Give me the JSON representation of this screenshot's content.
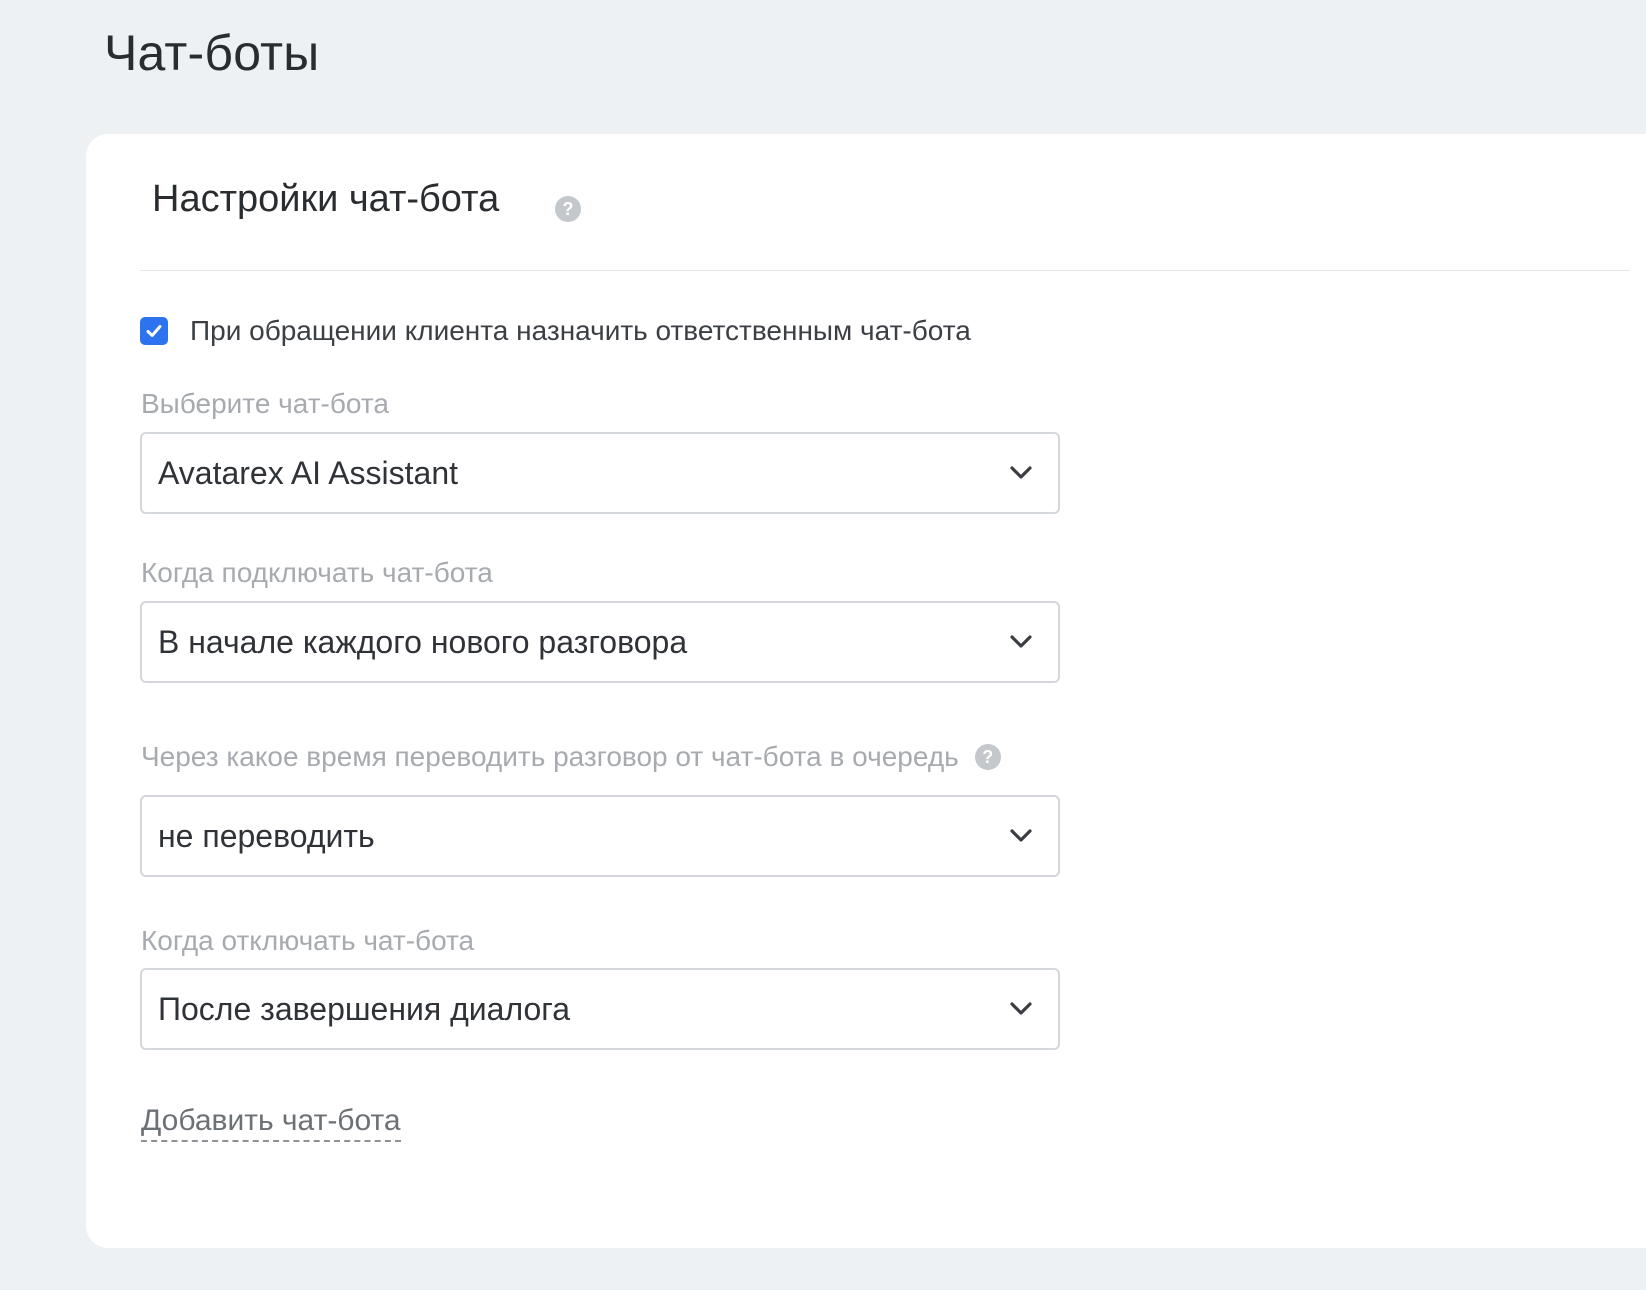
{
  "page": {
    "title": "Чат-боты"
  },
  "section": {
    "title": "Настройки чат-бота",
    "help_icon": "question-circle-icon"
  },
  "assign_checkbox": {
    "checked": true,
    "label": "При обращении клиента назначить ответственным чат-бота",
    "accent_color": "#2d72ef"
  },
  "fields": {
    "bot": {
      "label": "Выберите чат-бота",
      "value": "Avatarex AI Assistant"
    },
    "connect": {
      "label": "Когда подключать чат-бота",
      "value": "В начале каждого нового разговора"
    },
    "transfer": {
      "label": "Через какое время переводить разговор от чат-бота в очередь",
      "value": "не переводить",
      "help_icon": "question-circle-icon"
    },
    "disconnect": {
      "label": "Когда отключать чат-бота",
      "value": "После завершения диалога"
    }
  },
  "add_link": {
    "label": "Добавить чат-бота"
  },
  "icons": {
    "select_arrow": "chevron-down-icon",
    "check": "checkmark-icon"
  }
}
